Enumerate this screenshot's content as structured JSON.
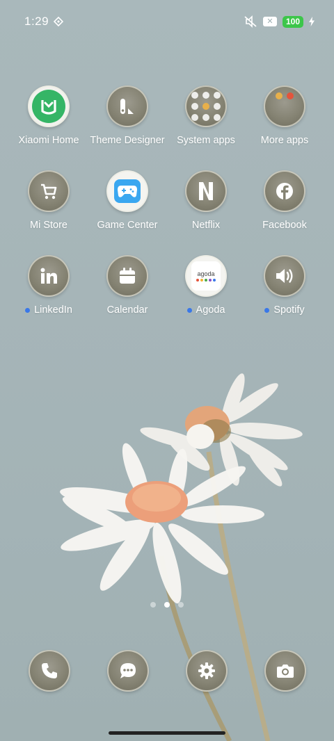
{
  "status_bar": {
    "time": "1:29",
    "battery": "100",
    "sim_badge": "✕"
  },
  "apps": [
    {
      "name": "Xiaomi Home",
      "icon": "xiaomi-home-icon",
      "new": false
    },
    {
      "name": "Theme Designer",
      "icon": "theme-designer-icon",
      "new": false
    },
    {
      "name": "System apps",
      "icon": "folder-icon",
      "new": false
    },
    {
      "name": "More apps",
      "icon": "folder-icon",
      "new": false
    },
    {
      "name": "Mi Store",
      "icon": "cart-icon",
      "new": false
    },
    {
      "name": "Game Center",
      "icon": "gamepad-icon",
      "new": false
    },
    {
      "name": "Netflix",
      "icon": "netflix-icon",
      "new": false
    },
    {
      "name": "Facebook",
      "icon": "facebook-icon",
      "new": false
    },
    {
      "name": "LinkedIn",
      "icon": "linkedin-icon",
      "new": true
    },
    {
      "name": "Calendar",
      "icon": "calendar-icon",
      "new": false
    },
    {
      "name": "Agoda",
      "icon": "agoda-icon",
      "new": true
    },
    {
      "name": "Spotify",
      "icon": "speaker-icon",
      "new": true
    }
  ],
  "agoda_text": "agoda",
  "dock": [
    {
      "icon": "phone-icon"
    },
    {
      "icon": "messages-icon"
    },
    {
      "icon": "settings-icon"
    },
    {
      "icon": "camera-icon"
    }
  ],
  "page_indicator": {
    "pages": 3,
    "current": 2
  },
  "colors": {
    "wallpaper": "#a6b5b8",
    "new_dot": "#3a78e8",
    "battery": "#3cc64a",
    "xiaomi_home": "#35b566",
    "game_center": "#3aa7f0"
  }
}
